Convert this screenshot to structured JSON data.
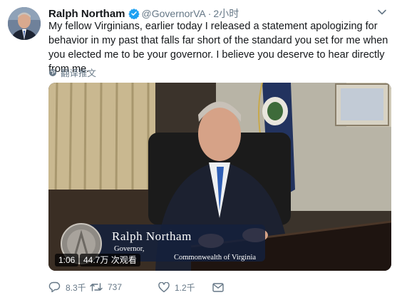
{
  "user": {
    "name": "Ralph Northam",
    "handle": "@GovernorVA",
    "separator": "·",
    "time": "2小时"
  },
  "tweet_text": "My fellow Virginians, earlier today I released a statement apologizing for behavior in my past that falls far short of the standard you set for me when you elected me to be your governor. I believe you deserve to hear directly from me.",
  "translate_label": "翻译推文",
  "video": {
    "name": "Ralph Northam",
    "title": "Governor,",
    "subtitle": "Commonwealth of Virginia",
    "duration": "1:06",
    "views": "44.7万 次观看"
  },
  "actions": {
    "replies": "8.3千",
    "retweets": "737",
    "likes": "1.2千",
    "dm": ""
  },
  "colors": {
    "verified": "#1da1f2",
    "secondary_text": "#657786",
    "primary_text": "#14171a"
  }
}
